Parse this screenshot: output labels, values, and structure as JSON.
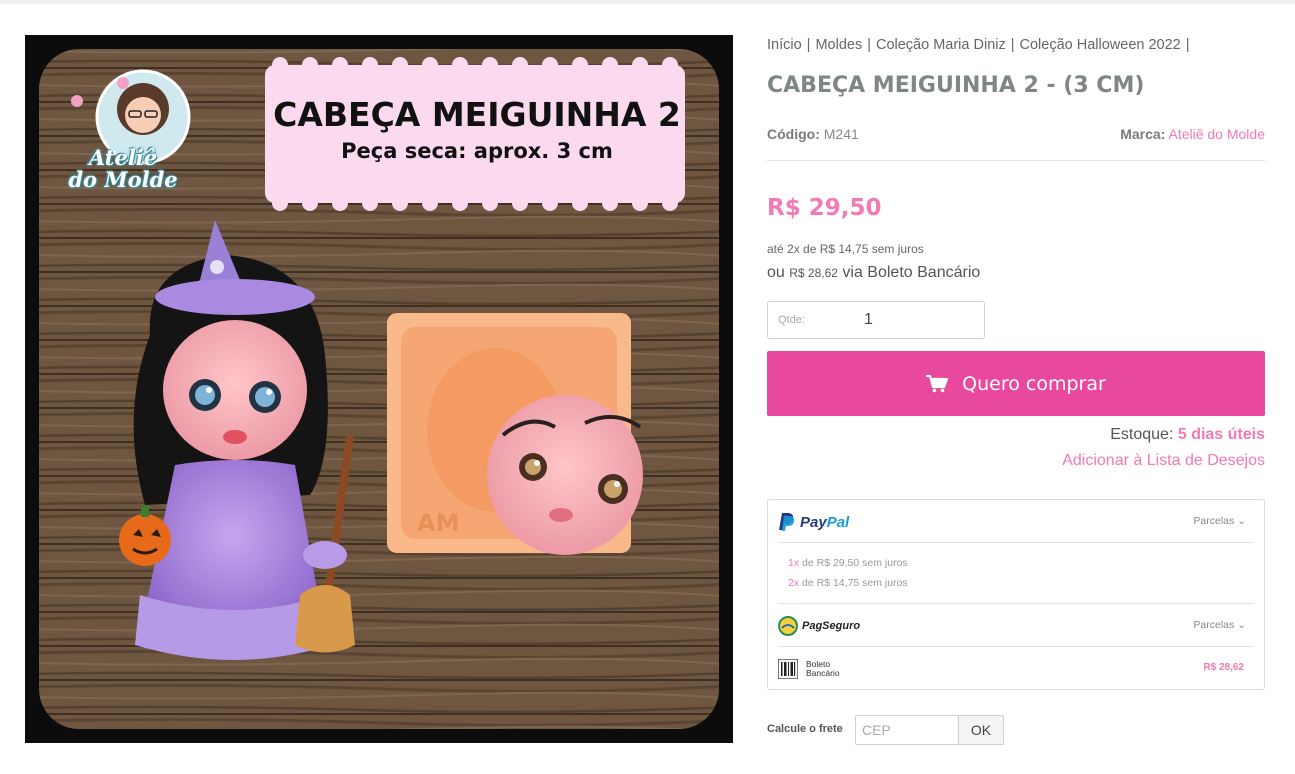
{
  "breadcrumb": [
    "Início",
    "Moldes",
    "Coleção Maria Diniz",
    "Coleção Halloween 2022"
  ],
  "image": {
    "title": "CABEÇA MEIGUINHA 2",
    "subtitle": "Peça seca: aprox. 3 cm",
    "logo": "Ateliê do Molde"
  },
  "product": {
    "title": "CABEÇA MEIGUINHA 2 - (3 CM)",
    "code_label": "Código:",
    "code": "M241",
    "brand_label": "Marca:",
    "brand": "Ateliê do Molde",
    "price": "R$ 29,50",
    "installments": "até 2x de R$ 14,75 sem juros",
    "boleto_prefix": "ou",
    "boleto_price": "R$ 28,62",
    "boleto_suffix": "via Boleto Bancário"
  },
  "quantity": {
    "label": "Qtde:",
    "value": "1"
  },
  "buy_button": {
    "label": "Quero comprar",
    "icon": "cart-icon"
  },
  "stock": {
    "label": "Estoque:",
    "value": "5 dias úteis"
  },
  "wishlist": "Adicionar à Lista de Desejos",
  "payments": {
    "paypal": {
      "name_a": "Pay",
      "name_b": "Pal",
      "parcelas": "Parcelas",
      "options": [
        {
          "n": "1x",
          "text": "de R$ 29,50 sem juros"
        },
        {
          "n": "2x",
          "text": "de R$ 14,75 sem juros"
        }
      ]
    },
    "pagseguro": {
      "name": "PagSeguro",
      "parcelas": "Parcelas"
    },
    "boleto": {
      "line1": "Boleto",
      "line2": "Bancário",
      "value": "R$ 28,62"
    }
  },
  "shipping": {
    "label": "Calcule o frete",
    "placeholder": "CEP",
    "button": "OK"
  },
  "colors": {
    "accent": "#e8489d",
    "pink_text": "#f07ab2",
    "title_gray": "#7f8688"
  }
}
